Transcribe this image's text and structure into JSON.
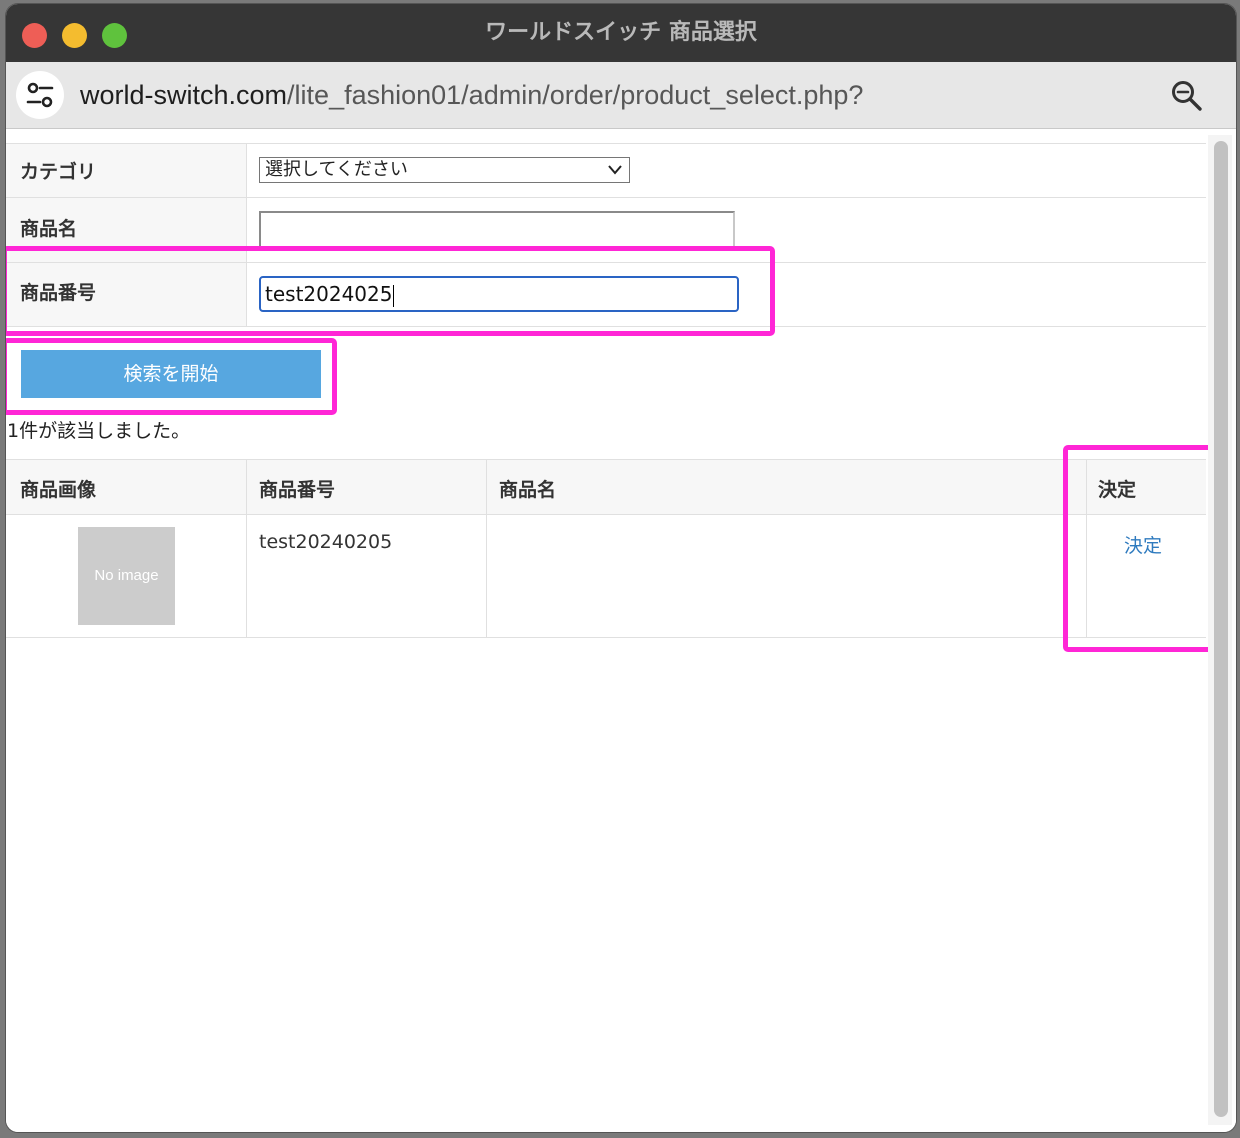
{
  "window": {
    "title": "ワールドスイッチ 商品選択"
  },
  "address_bar": {
    "domain": "world-switch.com",
    "path": "/lite_fashion01/admin/order/product_select.php?"
  },
  "search_form": {
    "category_label": "カテゴリ",
    "category_value": "選択してください",
    "product_name_label": "商品名",
    "product_name_value": "",
    "product_code_label": "商品番号",
    "product_code_value": "test2024025",
    "search_button": "検索を開始"
  },
  "results": {
    "count_text": "1件が該当しました。",
    "columns": [
      "商品画像",
      "商品番号",
      "商品名",
      "決定"
    ],
    "rows": [
      {
        "image_text": "No image",
        "code": "test20240205",
        "name": "",
        "action": "決定"
      }
    ]
  },
  "colors": {
    "highlight": "#ff26d6",
    "button": "#57a7e0",
    "link": "#2f7bbf"
  }
}
